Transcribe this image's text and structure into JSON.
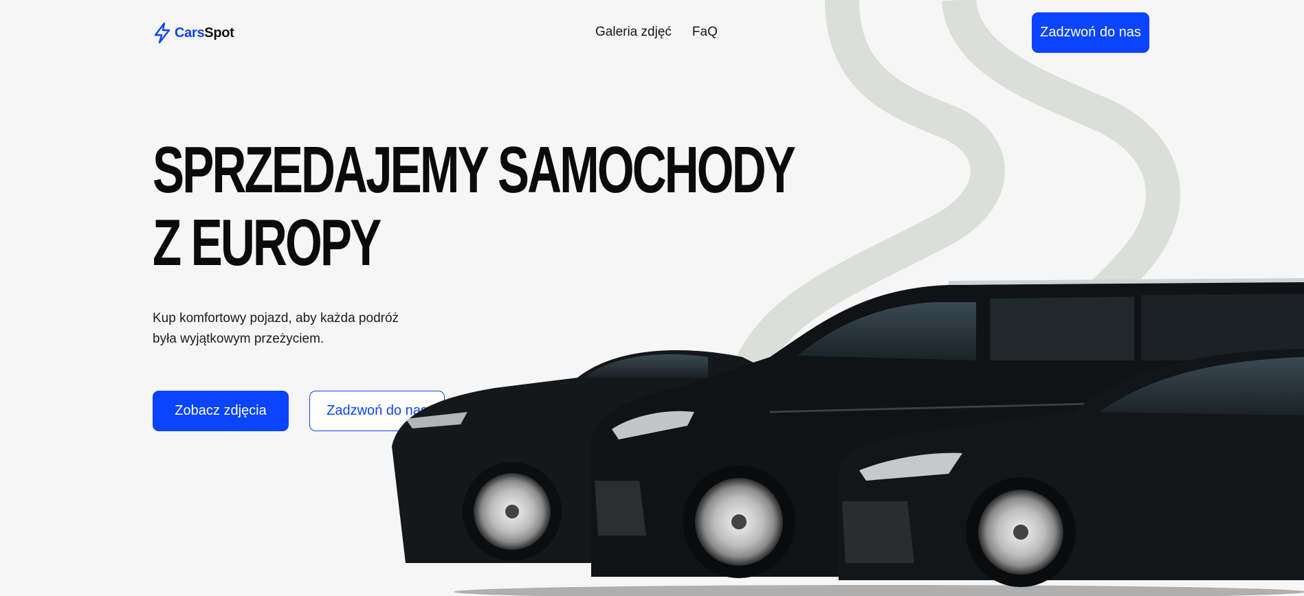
{
  "header": {
    "logo_part1": "Cars",
    "logo_part2": "Spot",
    "nav": [
      "Galeria zdjęć",
      "FaQ"
    ],
    "cta_label": "Zadzwoń do nas"
  },
  "hero": {
    "title_line1": "SPRZEDAJEMY SAMOCHODY",
    "title_line2": "Z EUROPY",
    "subtitle_line1": "Kup komfortowy pojazd, aby każda podróż",
    "subtitle_line2": "była wyjątkowym przeżyciem.",
    "primary_button": "Zobacz zdjęcia",
    "secondary_button": "Zadzwoń do nas"
  },
  "colors": {
    "accent": "#0a44ff",
    "background": "#f6f6f6",
    "road": "#dcdfd9",
    "car": "#121417"
  },
  "icons": {
    "logo": "lightning-bolt-icon"
  },
  "images": {
    "hero_cars": "three black cars (sedan, van, sedan) parked side by side"
  }
}
